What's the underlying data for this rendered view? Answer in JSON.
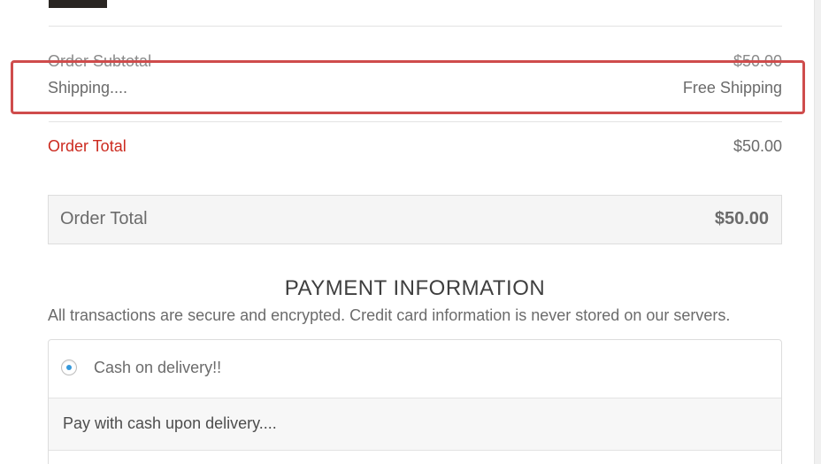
{
  "summary": {
    "subtotal_label": "Order Subtotal",
    "subtotal_value": "$50.00",
    "shipping_label": "Shipping....",
    "shipping_value": "Free Shipping",
    "order_total_label": "Order Total",
    "order_total_value": "$50.00"
  },
  "total_box": {
    "label": "Order Total",
    "amount": "$50.00"
  },
  "payment": {
    "title": "PAYMENT INFORMATION",
    "subtitle": "All transactions are secure and encrypted. Credit card information is never stored on our servers.",
    "option_label": "Cash on delivery!!",
    "option_selected": true,
    "option_description": "Pay with cash upon delivery...."
  },
  "colors": {
    "highlight_border": "#cf4c4c",
    "order_total_red": "#cc2a1f",
    "radio_dot": "#3498db"
  }
}
